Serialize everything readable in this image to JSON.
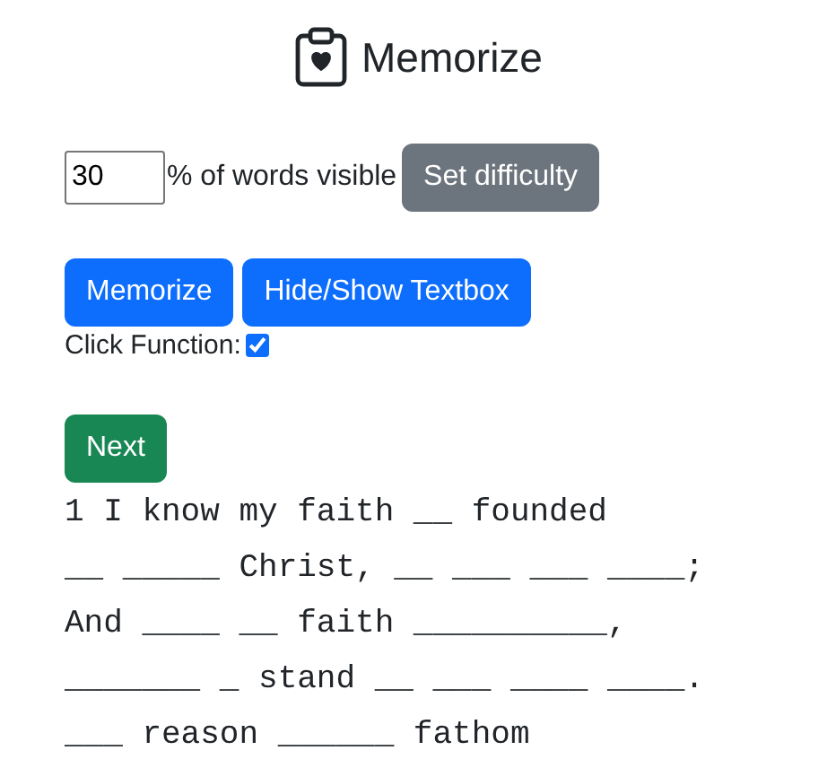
{
  "title": "Memorize",
  "difficulty": {
    "value": "30",
    "label": "% of words visible",
    "button": "Set difficulty"
  },
  "buttons": [
    "Memorize",
    "Hide/Show Textbox"
  ],
  "click_function": {
    "label": "Click Function:",
    "checked": true
  },
  "next_button": "Next",
  "verse_lines": [
    "1 I know my faith __ founded",
    "__ _____ Christ, __ ___ ___ ____;",
    "And ____ __ faith __________,",
    "_______ _ stand __ ___ ____ ____.",
    "___ reason ______ fathom"
  ]
}
